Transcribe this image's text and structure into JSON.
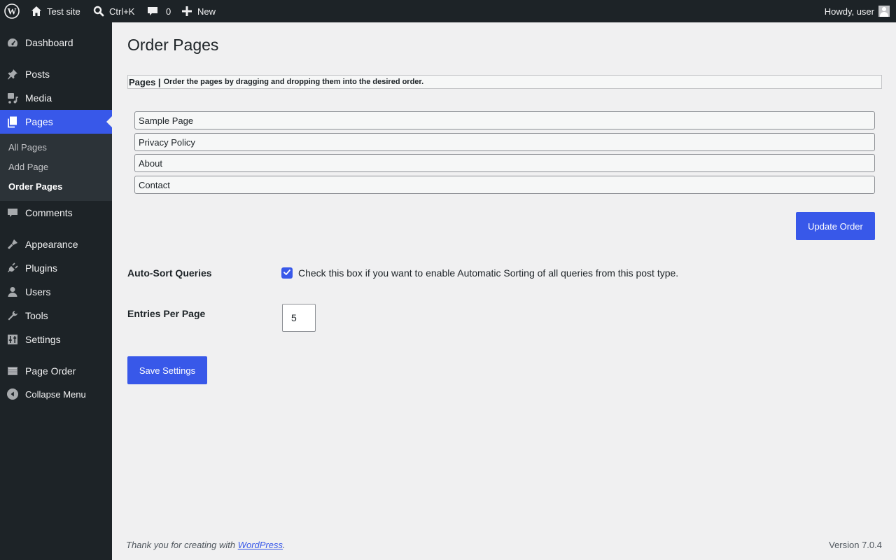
{
  "admin_bar": {
    "site_name": "Test site",
    "search_shortcut": "Ctrl+K",
    "comments_count": "0",
    "new_label": "New",
    "howdy": "Howdy, user"
  },
  "sidebar": {
    "items": [
      {
        "label": "Dashboard",
        "icon": "dashboard-icon"
      },
      {
        "label": "Posts",
        "icon": "pushpin-icon"
      },
      {
        "label": "Media",
        "icon": "media-icon"
      },
      {
        "label": "Pages",
        "icon": "pages-icon"
      },
      {
        "label": "Comments",
        "icon": "comment-bubble-icon"
      },
      {
        "label": "Appearance",
        "icon": "paintbrush-icon"
      },
      {
        "label": "Plugins",
        "icon": "plug-icon"
      },
      {
        "label": "Users",
        "icon": "user-icon"
      },
      {
        "label": "Tools",
        "icon": "wrench-icon"
      },
      {
        "label": "Settings",
        "icon": "sliders-icon"
      },
      {
        "label": "Page Order",
        "icon": "list-icon"
      }
    ],
    "submenu": [
      "All Pages",
      "Add Page",
      "Order Pages"
    ],
    "active_submenu": "Order Pages",
    "collapse_label": "Collapse Menu"
  },
  "main": {
    "title": "Order Pages",
    "pages_header": "Pages |",
    "pages_description": "Order the pages by dragging and dropping them into the desired order.",
    "pages": [
      "Sample Page",
      "Privacy Policy",
      "About",
      "Contact"
    ],
    "update_button": "Update Order",
    "autosort_label": "Auto-Sort Queries",
    "autosort_checked": true,
    "autosort_text": "Check this box if you want to enable Automatic Sorting of all queries from this post type.",
    "entries_label": "Entries Per Page",
    "entries_value": "5",
    "save_button": "Save Settings"
  },
  "footer": {
    "thanks_prefix": "Thank you for creating with",
    "link_text": "WordPress",
    "thanks_suffix": ".",
    "version": "Version 7.0.4"
  },
  "colors": {
    "accent": "#3858e9",
    "sidebar_bg": "#1d2327",
    "page_bg": "#f0f0f1"
  }
}
